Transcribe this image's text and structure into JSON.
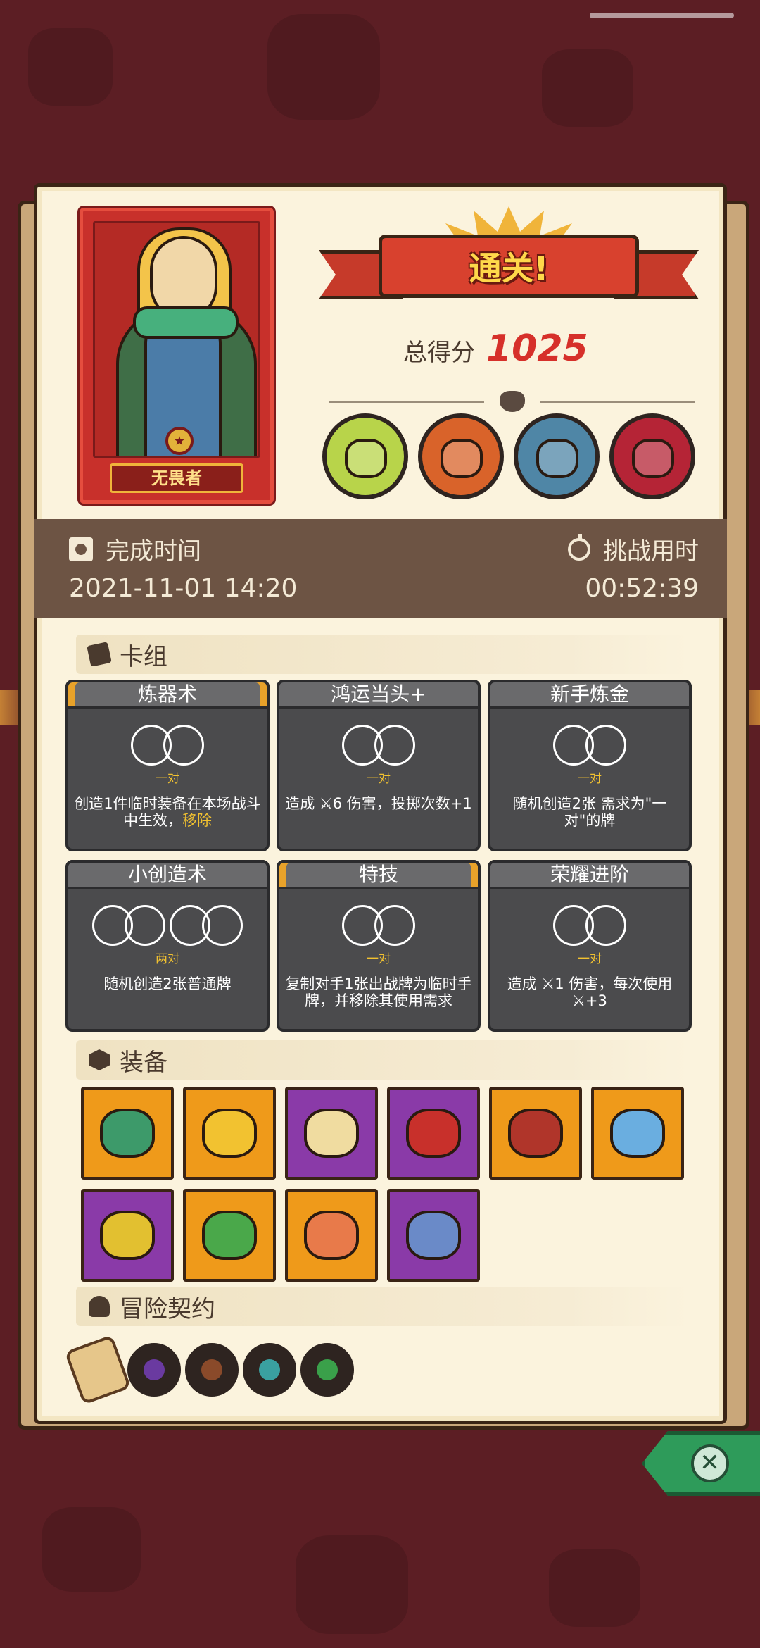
{
  "hero": {
    "name": "无畏者",
    "badge_icon": "star-emblem-icon"
  },
  "banner": {
    "title": "通关!"
  },
  "score": {
    "label": "总得分",
    "value": "1025"
  },
  "bosses": [
    {
      "name": "skeleton-dino-boss-icon",
      "color": "#b8d44a"
    },
    {
      "name": "orc-boss-icon",
      "color": "#d9632a"
    },
    {
      "name": "rhino-boss-icon",
      "color": "#4f86a6"
    },
    {
      "name": "vampire-boss-icon",
      "color": "#b52436"
    }
  ],
  "time": {
    "complete_label": "完成时间",
    "complete_value": "2021-11-01 14:20",
    "challenge_label": "挑战用时",
    "challenge_value": "00:52:39"
  },
  "deck": {
    "header": "卡组",
    "cards": [
      {
        "title": "炼器术",
        "cost": "一对",
        "desc": "创造1件临时装备在本场战斗中生效，",
        "highlight": "移除",
        "rings": 2,
        "gold": true
      },
      {
        "title": "鸿运当头+",
        "cost": "一对",
        "desc": "造成 ⚔6 伤害，投掷次数+1",
        "highlight": "",
        "rings": 2,
        "gold": false
      },
      {
        "title": "新手炼金",
        "cost": "一对",
        "desc": "随机创造2张 需求为\"一对\"的牌",
        "highlight": "",
        "rings": 2,
        "gold": false
      },
      {
        "title": "小创造术",
        "cost": "两对",
        "desc": "随机创造2张普通牌",
        "highlight": "",
        "rings": 4,
        "gold": false
      },
      {
        "title": "特技",
        "cost": "一对",
        "desc": "复制对手1张出战牌为临时手牌，并移除其使用需求",
        "highlight": "",
        "rings": 2,
        "gold": true
      },
      {
        "title": "荣耀进阶",
        "cost": "一对",
        "desc": "造成 ⚔1 伤害，每次使用⚔+3",
        "highlight": "",
        "rings": 2,
        "gold": false
      }
    ]
  },
  "equipment": {
    "header": "装备",
    "items": [
      {
        "name": "turtle-shell-icon",
        "bg": "orange",
        "color": "#3d9a6a"
      },
      {
        "name": "crown-icon",
        "bg": "orange",
        "color": "#f2c230"
      },
      {
        "name": "mirror-icon",
        "bg": "purple",
        "color": "#f0dca0"
      },
      {
        "name": "bracelet-icon",
        "bg": "purple",
        "color": "#c8302b"
      },
      {
        "name": "hood-icon",
        "bg": "orange",
        "color": "#b0352a"
      },
      {
        "name": "crystal-blade-icon",
        "bg": "orange",
        "color": "#6aaee0"
      },
      {
        "name": "emerald-ring-icon",
        "bg": "purple",
        "color": "#e2c030"
      },
      {
        "name": "moss-tablet-icon",
        "bg": "orange",
        "color": "#4aa84a"
      },
      {
        "name": "shield-disc-icon",
        "bg": "orange",
        "color": "#e87a4a"
      },
      {
        "name": "tunic-icon",
        "bg": "purple",
        "color": "#6a8ac8"
      }
    ]
  },
  "contracts": {
    "header": "冒险契约",
    "items": [
      {
        "name": "scroll-icon",
        "color": "#e6c68a"
      },
      {
        "name": "eye-sigil-icon",
        "color": "#6a3aa0"
      },
      {
        "name": "pipe-icon",
        "color": "#8a4a2a"
      },
      {
        "name": "gear-coin-icon",
        "color": "#3aa0a0"
      },
      {
        "name": "bird-leaf-icon",
        "color": "#3aa04a"
      }
    ]
  },
  "close": {
    "icon": "close-icon",
    "glyph": "✕"
  }
}
